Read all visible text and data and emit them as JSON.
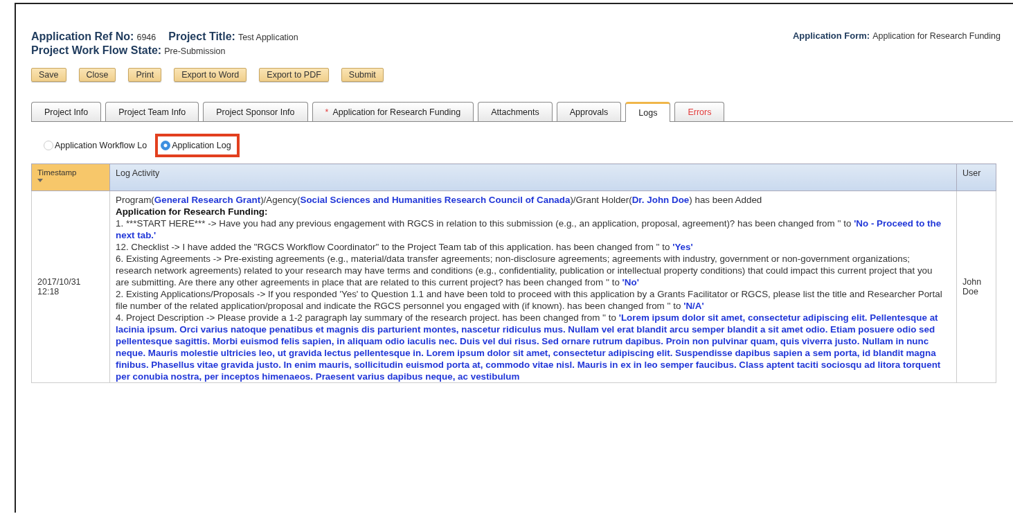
{
  "header": {
    "ref_label": "Application Ref No:",
    "ref_value": "6946",
    "title_label": "Project Title:",
    "title_value": "Test Application",
    "state_label": "Project Work Flow State:",
    "state_value": "Pre-Submission",
    "form_label": "Application Form:",
    "form_value": "Application for Research Funding"
  },
  "buttons": [
    "Save",
    "Close",
    "Print",
    "Export to Word",
    "Export to PDF",
    "Submit"
  ],
  "tabs": [
    {
      "label": "Project Info",
      "selected": false,
      "alert": false
    },
    {
      "label": "Project Team Info",
      "selected": false,
      "alert": false
    },
    {
      "label": "Project Sponsor Info",
      "selected": false,
      "alert": false
    },
    {
      "label": "Application for Research Funding",
      "marker": "*",
      "selected": false,
      "alert": false
    },
    {
      "label": "Attachments",
      "selected": false,
      "alert": false
    },
    {
      "label": "Approvals",
      "selected": false,
      "alert": false
    },
    {
      "label": "Logs",
      "selected": true,
      "alert": false
    },
    {
      "label": "Errors",
      "selected": false,
      "alert": true
    }
  ],
  "log_options": [
    {
      "label": "Application Workflow Lo",
      "selected": false,
      "highlighted": false
    },
    {
      "label": "Application Log",
      "selected": true,
      "highlighted": true
    }
  ],
  "table": {
    "columns": [
      {
        "label": "Timestamp",
        "sorted": true
      },
      {
        "label": "Log Activity",
        "sorted": false
      },
      {
        "label": "User",
        "sorted": false
      }
    ],
    "rows": [
      {
        "timestamp": "2017/10/31 12:18",
        "user": "John Doe",
        "entries": [
          {
            "kind": "text",
            "parts": [
              {
                "text": "Program(",
                "value": false
              },
              {
                "text": "General Research Grant",
                "value": true
              },
              {
                "text": ")/Agency(",
                "value": false
              },
              {
                "text": "Social Sciences and Humanities Research Council of Canada",
                "value": true
              },
              {
                "text": ")/Grant Holder(",
                "value": false
              },
              {
                "text": "Dr. John Doe",
                "value": true
              },
              {
                "text": ") has been Added",
                "value": false
              }
            ]
          },
          {
            "kind": "heading",
            "parts": [
              {
                "text": "Application for Research Funding:",
                "value": false
              }
            ]
          },
          {
            "kind": "text",
            "parts": [
              {
                "text": "1. ***START HERE*** -> Have you had any previous engagement with RGCS in relation to this submission (e.g., an application, proposal, agreement)? has been changed from '' to ",
                "value": false
              },
              {
                "text": "'No - Proceed to the next tab.'",
                "value": true
              }
            ]
          },
          {
            "kind": "text",
            "parts": [
              {
                "text": "12. Checklist -> I have added the \"RGCS Workflow Coordinator\" to the Project Team tab of this application. has been changed from '' to ",
                "value": false
              },
              {
                "text": "'Yes'",
                "value": true
              }
            ]
          },
          {
            "kind": "text",
            "parts": [
              {
                "text": "6. Existing Agreements -> Pre-existing agreements (e.g., material/data transfer agreements; non-disclosure agreements; agreements with industry, government or non-government organizations; research network agreements) related to your research may have terms and conditions (e.g., confidentiality, publication or intellectual property conditions) that could impact this current project that you are submitting. Are there any other agreements in place that are related to this current project? has been changed from '' to ",
                "value": false
              },
              {
                "text": "'No'",
                "value": true
              }
            ]
          },
          {
            "kind": "text",
            "parts": [
              {
                "text": "2. Existing Applications/Proposals -> If you responded 'Yes' to Question 1.1 and have been told to proceed with this application by a Grants Facilitator or RGCS, please list the title and Researcher Portal file number of the related application/proposal and indicate the RGCS personnel you engaged with (if known). has been changed from '' to ",
                "value": false
              },
              {
                "text": "'N/A'",
                "value": true
              }
            ]
          },
          {
            "kind": "text",
            "parts": [
              {
                "text": "4. Project Description -> Please provide a 1-2 paragraph lay summary of the research project. has been changed from '' to ",
                "value": false
              },
              {
                "text": "'Lorem ipsum dolor sit amet, consectetur adipiscing elit. Pellentesque at lacinia ipsum. Orci varius natoque penatibus et magnis dis parturient montes, nascetur ridiculus mus. Nullam vel erat blandit arcu semper blandit a sit amet odio. Etiam posuere odio sed pellentesque sagittis. Morbi euismod felis sapien, in aliquam odio iaculis nec. Duis vel dui risus. Sed ornare rutrum dapibus. Proin non pulvinar quam, quis viverra justo. Nullam in nunc neque. Mauris molestie ultricies leo, ut gravida lectus pellentesque in. Lorem ipsum dolor sit amet, consectetur adipiscing elit. Suspendisse dapibus sapien a sem porta, id blandit magna finibus. Phasellus vitae gravida justo. In enim mauris, sollicitudin euismod porta at, commodo vitae nisl. Mauris in ex in leo semper faucibus. Class aptent taciti sociosqu ad litora torquent per conubia nostra, per inceptos himenaeos. Praesent varius dapibus neque, ac vestibulum",
                "value": true
              }
            ]
          }
        ]
      }
    ]
  }
}
